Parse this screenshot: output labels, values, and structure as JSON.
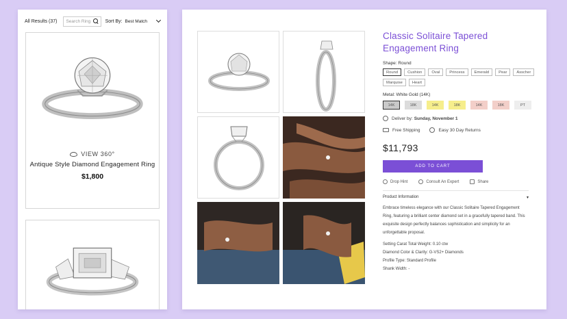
{
  "results": {
    "count_label": "All Results (37)",
    "search_placeholder": "Search Ring",
    "sort_label": "Sort By:",
    "sort_value": "Best Match"
  },
  "cards": [
    {
      "view_label": "VIEW 360°",
      "title": "Antique Style Diamond Engagement Ring",
      "price": "$1,800"
    },
    {
      "view_label": "",
      "title": "",
      "price": ""
    }
  ],
  "product": {
    "title": "Classic Solitaire Tapered Engagement Ring",
    "shape_label": "Shape: Round",
    "shapes": [
      "Round",
      "Cushion",
      "Oval",
      "Princess",
      "Emerald",
      "Pear",
      "Asscher",
      "Marquise",
      "Heart"
    ],
    "active_shape": "Round",
    "metal_label": "Metal: White Gold (14K)",
    "metals": [
      {
        "label": "14K",
        "color": "#c9c9c9"
      },
      {
        "label": "18K",
        "color": "#dcdcdc"
      },
      {
        "label": "14K",
        "color": "#f6ee8c"
      },
      {
        "label": "18K",
        "color": "#f6ee8c"
      },
      {
        "label": "14K",
        "color": "#f3cfc9"
      },
      {
        "label": "18K",
        "color": "#f3cfc9"
      },
      {
        "label": "PT",
        "color": "#eeeeee"
      }
    ],
    "deliver_prefix": "Deliver by: ",
    "deliver_date": "Sunday, November 1",
    "free_shipping": "Free Shipping",
    "returns": "Easy 30 Day Returns",
    "price": "$11,793",
    "cart_button": "ADD TO CART",
    "drop_hint": "Drop Hint",
    "consult": "Consult An Expert",
    "share": "Share",
    "info_heading": "Product Information",
    "description": "Embrace timeless elegance with our Classic Solitaire Tapered Engagement Ring, featuring a brilliant center diamond set in a gracefully tapered band. This exquisite design perfectly balances sophistication and simplicity for an unforgettable proposal.",
    "specs": [
      "Setting Carat Total Weight: 0.10 ctw",
      "Diamond Color & Clarity: G-VS2+ Diamonds",
      "Profile Type: Standard Profile",
      "Shank Width: -"
    ]
  },
  "colors": {
    "accent": "#7b4fd6",
    "background": "#d9ccf5"
  }
}
